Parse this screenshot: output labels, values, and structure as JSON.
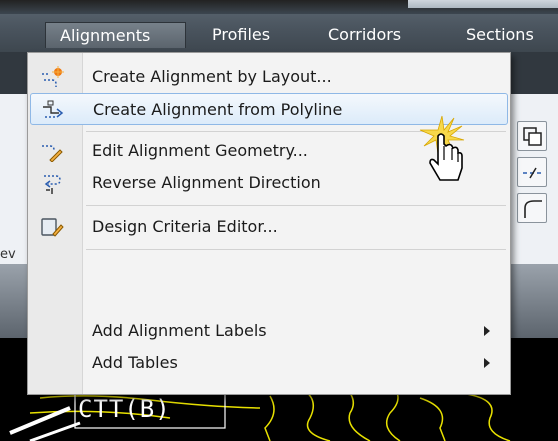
{
  "menubar": {
    "tabs": [
      {
        "label": "Alignments",
        "active": true
      },
      {
        "label": "Profiles",
        "active": false
      },
      {
        "label": "Corridors",
        "active": false
      },
      {
        "label": "Sections",
        "active": false
      }
    ]
  },
  "menu": {
    "items": [
      {
        "label": "Create Alignment by Layout...",
        "icon": "alignment-layout-icon"
      },
      {
        "label": "Create Alignment from Polyline",
        "icon": "alignment-polyline-icon",
        "highlighted": true
      },
      {
        "label": "Edit Alignment Geometry...",
        "icon": "edit-geometry-icon"
      },
      {
        "label": "Reverse Alignment Direction",
        "icon": "reverse-direction-icon"
      },
      {
        "label": "Design Criteria Editor...",
        "icon": "design-criteria-icon"
      },
      {
        "label": "Add Alignment Labels",
        "submenu": true
      },
      {
        "label": "Add Tables",
        "submenu": true
      }
    ]
  },
  "ribbon": {
    "partial_label": "ev"
  },
  "drawing": {
    "text": "CTT(B)"
  },
  "colors": {
    "accent_orange": "#f07a12",
    "highlight_border": "#8fb8e6",
    "contour_yellow": "#e8e100"
  }
}
